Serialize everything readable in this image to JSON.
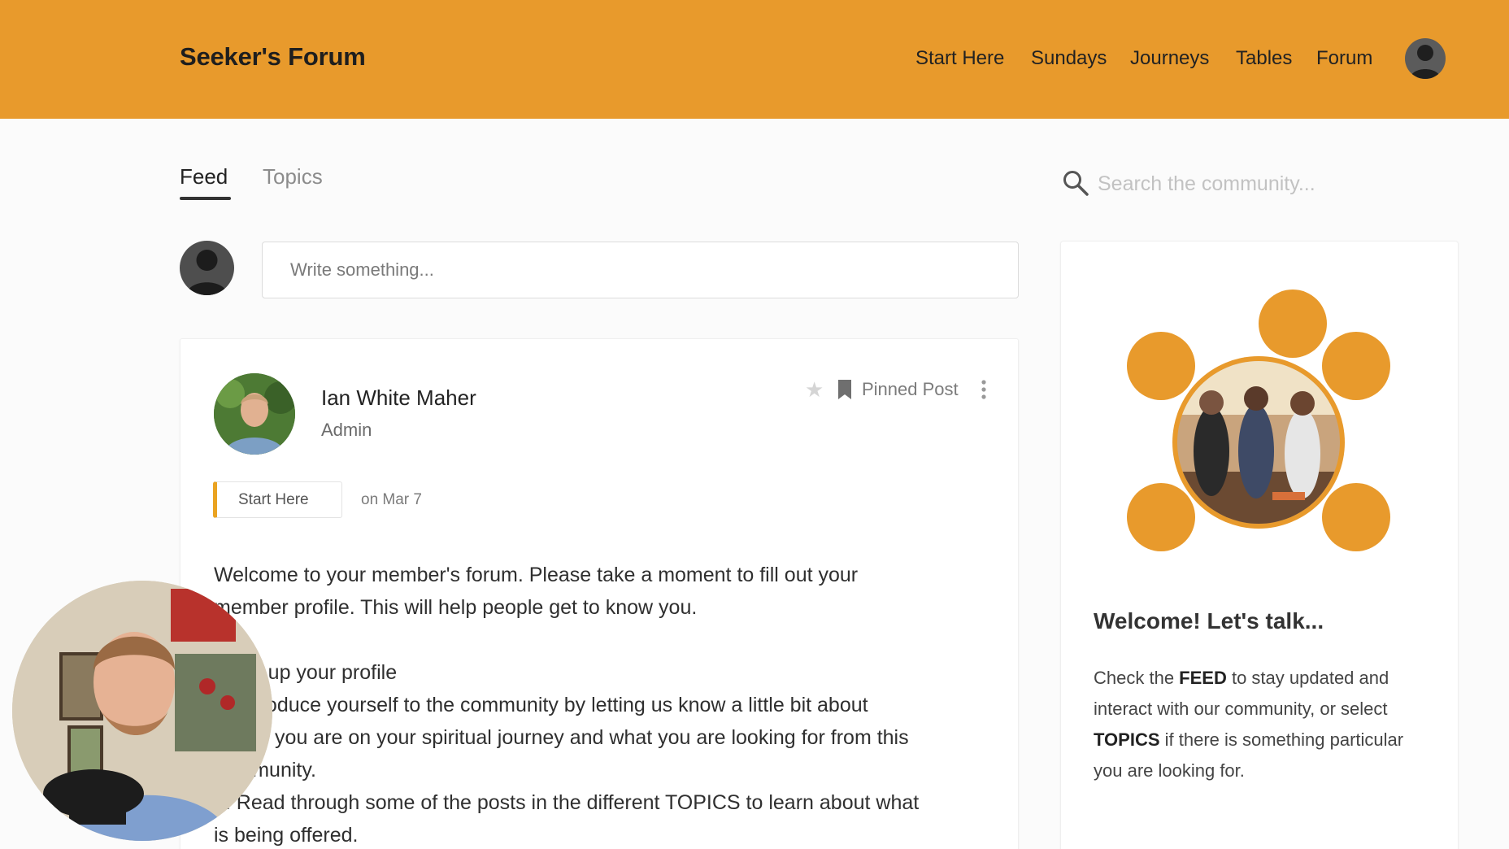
{
  "header": {
    "brand": "Seeker's Forum",
    "nav": [
      "Start Here",
      "Sundays",
      "Journeys",
      "Tables",
      "Forum"
    ]
  },
  "tabs": [
    "Feed",
    "Topics"
  ],
  "search": {
    "placeholder": "Search the community..."
  },
  "composer": {
    "placeholder": "Write something..."
  },
  "post": {
    "author_name": "Ian White Maher",
    "author_role": "Admin",
    "pinned_label": "Pinned Post",
    "tag": "Start Here",
    "date": "on Mar 7",
    "lines": [
      "Welcome to your member's forum. Please take a moment to fill out your",
      "member profile. This will help people get to know you.",
      "",
      "1. Fill up your profile",
      "2. Introduce yourself to the community by letting us know a little bit about",
      "where you are on your spiritual journey and what you are looking for from this",
      "community.",
      "3. Read through some of the posts in the different TOPICS to learn about what",
      "is being offered."
    ]
  },
  "sidebar": {
    "title": "Welcome! Let's talk...",
    "text_parts": [
      "Check the ",
      "FEED",
      " to stay updated and interact with our community, or select ",
      "TOPICS",
      " if there is something particular you are looking for."
    ]
  },
  "colors": {
    "header_bg": "#e89a2c",
    "accent": "#eaa321"
  }
}
